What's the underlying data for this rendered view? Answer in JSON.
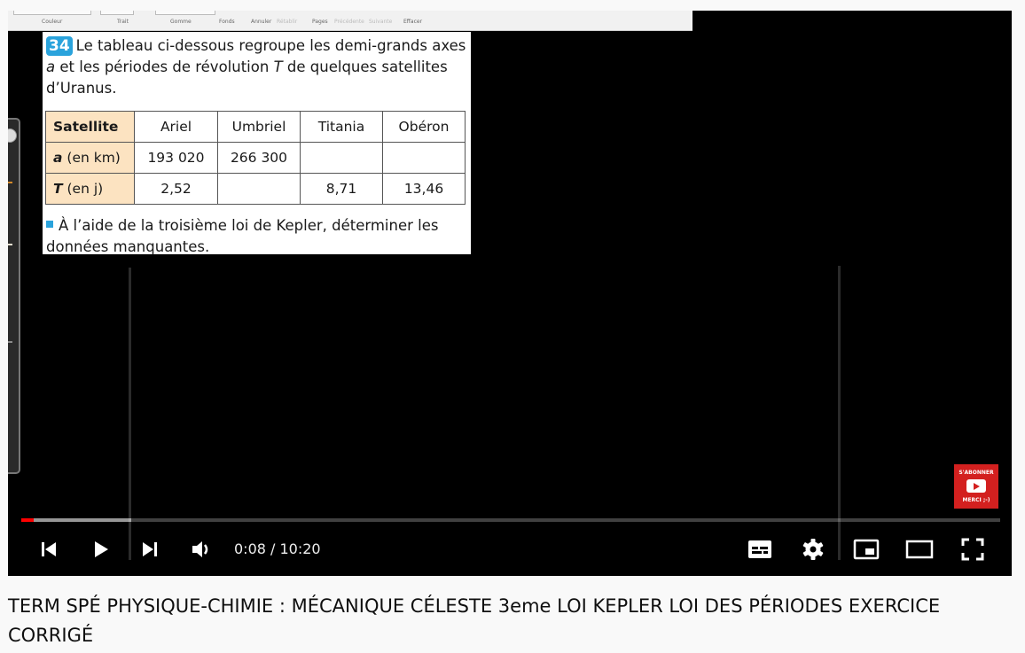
{
  "whiteboard_toolbar": {
    "tools": [
      "Couleur",
      "Trait",
      "Gomme",
      "Fonds",
      "Annuler",
      "Rétablir",
      "Pages",
      "Précédente",
      "Suivante",
      "Effacer"
    ]
  },
  "exercise": {
    "number": "34",
    "intro_line1": "Le tableau ci-dessous regroupe les demi-grands axes",
    "intro_line2_var": "a",
    "intro_line2_text": " et les périodes de révolution ",
    "intro_line2_var2": "T",
    "intro_line2_text2": " de quelques satellites",
    "intro_line3": "d’Uranus.",
    "table": {
      "header": [
        "Satellite",
        "Ariel",
        "Umbriel",
        "Titania",
        "Obéron"
      ],
      "rows": [
        {
          "label_var": "a",
          "label_unit": " (en km)",
          "cells": [
            "193 020",
            "266 300",
            "",
            ""
          ]
        },
        {
          "label_var": "T",
          "label_unit": " (en j)",
          "cells": [
            "2,52",
            "",
            "8,71",
            "13,46"
          ]
        }
      ]
    },
    "task_line1": "À l’aide de la troisième loi de Kepler, déterminer les",
    "task_line2": "données manquantes."
  },
  "subscribe_badge": {
    "top": "S'ABONNER",
    "bottom": "MERCI ;-)"
  },
  "player": {
    "progress": 0.013,
    "buffered": 0.112,
    "current_time": "0:08",
    "duration": "10:20",
    "time_display": "0:08 / 10:20",
    "accent_color": "#ff0000"
  },
  "controls": {
    "left": [
      "previous-icon",
      "play-icon",
      "next-icon",
      "volume-icon"
    ],
    "right": [
      "subtitles-icon",
      "settings-icon",
      "miniplayer-icon",
      "theater-icon",
      "fullscreen-icon"
    ]
  },
  "video": {
    "title": "TERM SPÉ PHYSIQUE-CHIMIE : MÉCANIQUE CÉLESTE 3eme LOI KEPLER LOI DES PÉRIODES EXERCICE CORRIGÉ"
  }
}
